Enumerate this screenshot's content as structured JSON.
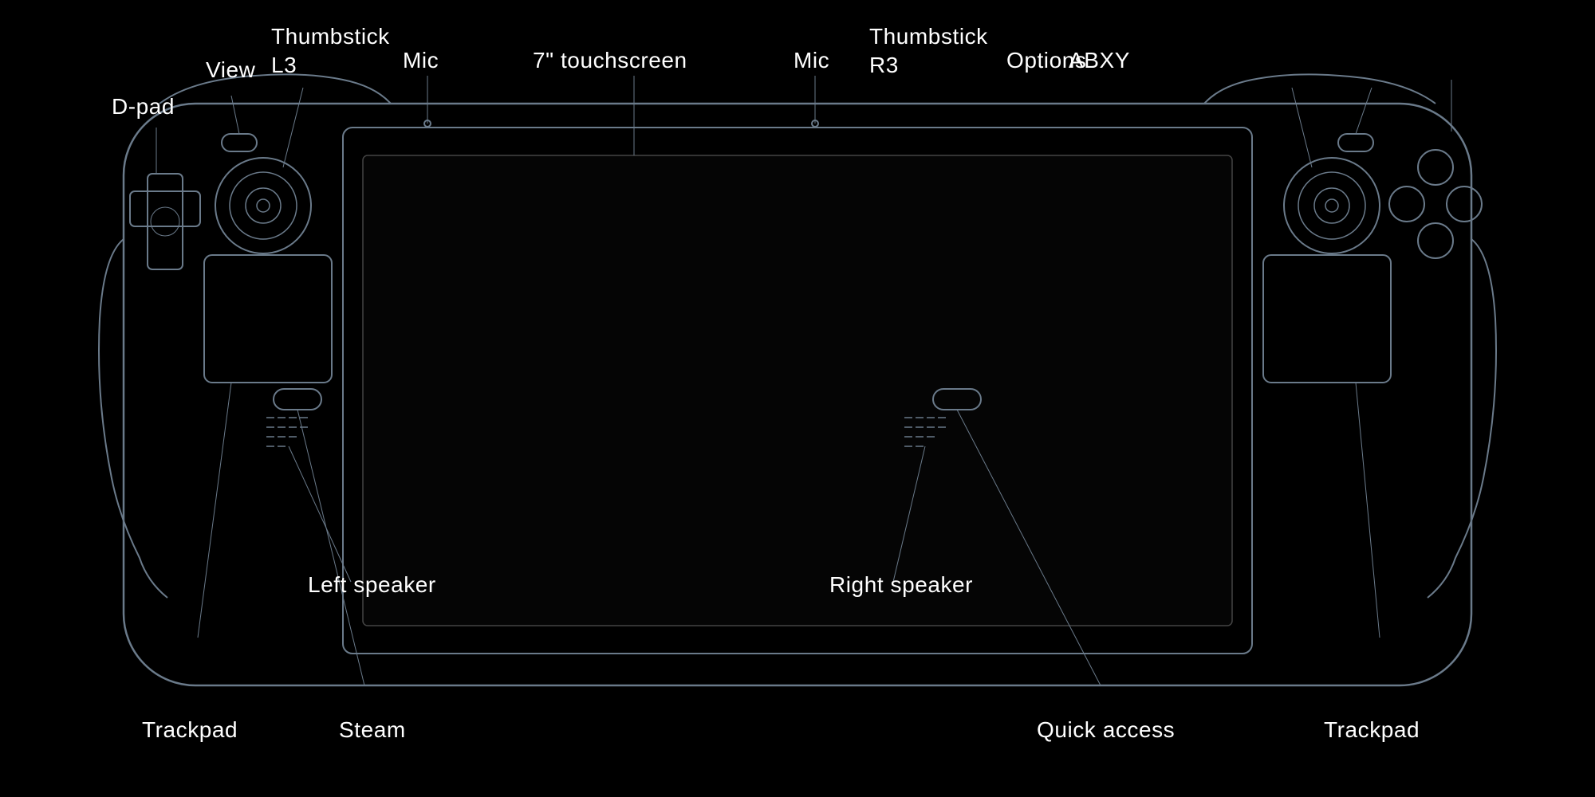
{
  "labels": {
    "dpad": "D-pad",
    "view": "View",
    "thumbstick_l3": "Thumbstick\nL3",
    "mic_left": "Mic",
    "touchscreen": "7\" touchscreen",
    "mic_right": "Mic",
    "thumbstick_r3": "Thumbstick\nR3",
    "options": "Options",
    "abxy": "ABXY",
    "left_speaker": "Left speaker",
    "steam": "Steam",
    "trackpad_left": "Trackpad",
    "right_speaker": "Right speaker",
    "quick_access": "Quick access",
    "trackpad_right": "Trackpad"
  },
  "colors": {
    "outline": "#6a7a8a",
    "background": "#000000",
    "screen": "#0a0a0a",
    "text": "#ffffff"
  }
}
